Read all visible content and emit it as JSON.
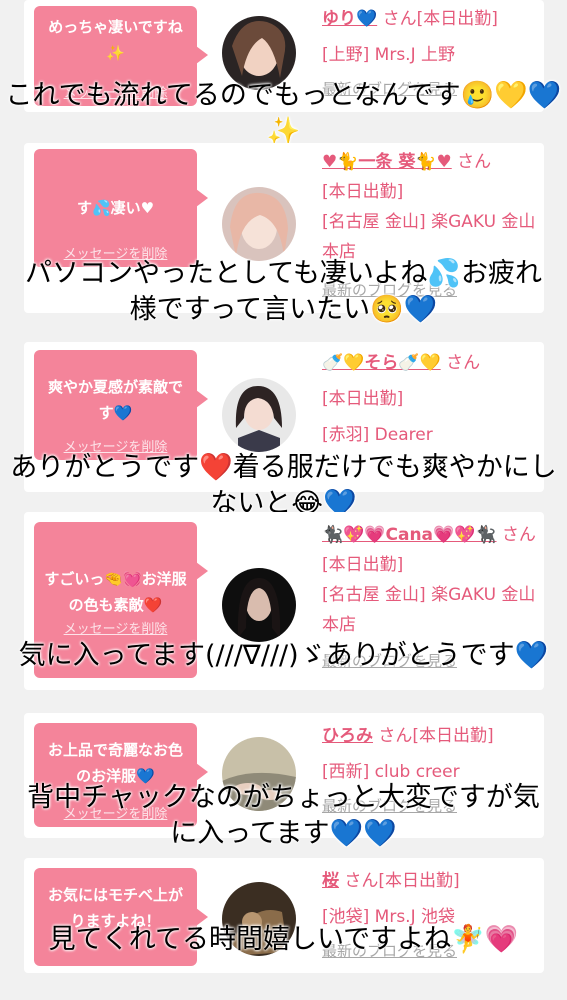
{
  "cards": [
    {
      "bubble": "めっちゃ凄いですね✨",
      "delete_label": "メッセージを削除",
      "name": "ゆり💙",
      "suffix": " さん[本日出勤]",
      "location": "[上野] Mrs.J 上野",
      "blog": "最新のブログを見る",
      "overlay": "これでも流れてるのでもっとなんです🥲💛💙✨"
    },
    {
      "bubble": "す💦凄い♥",
      "delete_label": "メッセージを削除",
      "name": "♥🐈一条 葵🐈♥",
      "suffix": " さん",
      "status": "[本日出勤]",
      "location": "[名古屋 金山] 楽GAKU 金山本店",
      "blog": "最新のブログを見る",
      "overlay": "パソコンやったとしても凄いよね💦お疲れ様ですって言いたい🥺💙"
    },
    {
      "bubble": "爽やか夏感が素敵です💙",
      "delete_label": "メッセージを削除",
      "name": "🍼💛そら🍼💛",
      "suffix": " さん",
      "status": "[本日出勤]",
      "location": "[赤羽] Dearer",
      "blog": "最新のブログを見る",
      "overlay": "ありがとうです❤️着る服だけでも爽やかにしないと😂💙"
    },
    {
      "bubble": "すごいっ🤏💓お洋服の色も素敵❤️",
      "delete_label": "メッセージを削除",
      "name": "🐈‍⬛💖💗Cana💗💖🐈‍⬛",
      "suffix": " さん[本日出勤]",
      "location": "[名古屋 金山] 楽GAKU 金山本店",
      "blog": "最新のブログを見る",
      "overlay": "気に入ってます(///∇///)ゞありがとうです💙"
    },
    {
      "bubble": "お上品で奇麗なお色のお洋服💙",
      "delete_label": "メッセージを削除",
      "name": "ひろみ",
      "suffix": " さん[本日出勤]",
      "location": "[西新] club creer",
      "blog": "最新のブログを見る",
      "overlay": "背中チャックなのがちょっと大変ですが気に入ってます💙💙"
    },
    {
      "bubble": "お気にはモチベ上がりますよね！",
      "delete_label": "メッセージを削除",
      "name": "桜",
      "suffix": " さん[本日出勤]",
      "location": "[池袋] Mrs.J 池袋",
      "blog": "最新のブログを見る",
      "overlay": "見てくれてる時間嬉しいですよね🧚💗"
    }
  ],
  "colors": {
    "accent": "#f4849a",
    "link": "#e55a7b",
    "background": "#f1f1f1"
  }
}
